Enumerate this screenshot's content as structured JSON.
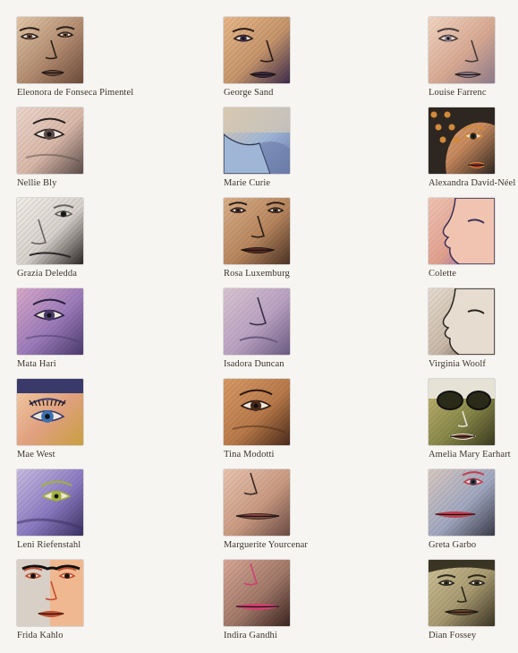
{
  "portraits": [
    {
      "name": "Eleonora de Fonseca Pimentel",
      "palette": [
        "#b08a6e",
        "#6a4a3a",
        "#e2c7a8",
        "#2a1f1a"
      ],
      "feature": "eyes-nose"
    },
    {
      "name": "George Sand",
      "palette": [
        "#c6956a",
        "#3b2a4a",
        "#e8b889",
        "#2a1c18"
      ],
      "feature": "eye-nose"
    },
    {
      "name": "Louise Farrenc",
      "palette": [
        "#d6a890",
        "#8c7a8a",
        "#f0d4c0",
        "#4a3a3a"
      ],
      "feature": "eye-nose"
    },
    {
      "name": "Nellie Bly",
      "palette": [
        "#d8b8a8",
        "#5a4a48",
        "#ecd6cc",
        "#2a2220"
      ],
      "feature": "eye"
    },
    {
      "name": "Marie Curie",
      "palette": [
        "#9fb6d6",
        "#6a7aa8",
        "#d9c9b0",
        "#2e3550"
      ],
      "feature": "collar"
    },
    {
      "name": "Alexandra David-Néel",
      "palette": [
        "#c98a5e",
        "#2e2620",
        "#e0b088",
        "#d08a3a"
      ],
      "feature": "eye-hair"
    },
    {
      "name": "Grazia Deledda",
      "palette": [
        "#d8d2cc",
        "#2a2626",
        "#f0ece6",
        "#6a6460"
      ],
      "feature": "nose-bw"
    },
    {
      "name": "Rosa Luxemburg",
      "palette": [
        "#b8865e",
        "#4a3224",
        "#dab08a",
        "#2a1e16"
      ],
      "feature": "nose-mouth"
    },
    {
      "name": "Colette",
      "palette": [
        "#e0a08a",
        "#6a5ac0",
        "#f0c4b0",
        "#3a3058"
      ],
      "feature": "profile"
    },
    {
      "name": "Mata Hari",
      "palette": [
        "#9a7ab8",
        "#4a3a6a",
        "#d8a8c8",
        "#2a2040"
      ],
      "feature": "eye"
    },
    {
      "name": "Isadora Duncan",
      "palette": [
        "#b8a0c0",
        "#6a5a80",
        "#d8c4d0",
        "#3a3048"
      ],
      "feature": "nose"
    },
    {
      "name": "Virginia Woolf",
      "palette": [
        "#c8b8a8",
        "#4a3e36",
        "#e6dccf",
        "#2a2420"
      ],
      "feature": "profile"
    },
    {
      "name": "Mae West",
      "palette": [
        "#e0a080",
        "#c8a040",
        "#f4cfa8",
        "#3a3a6a"
      ],
      "feature": "eye-lash"
    },
    {
      "name": "Tina Modotti",
      "palette": [
        "#b87a4a",
        "#4a2a1a",
        "#d89a68",
        "#2a1810"
      ],
      "feature": "eye"
    },
    {
      "name": "Amelia Mary Earhart",
      "palette": [
        "#8a8a4a",
        "#3a3a20",
        "#c8b878",
        "#e6e2d6"
      ],
      "feature": "goggles"
    },
    {
      "name": "Leni Riefenstahl",
      "palette": [
        "#8a7ac0",
        "#3a3060",
        "#c8bce0",
        "#a0b040"
      ],
      "feature": "eye-green"
    },
    {
      "name": "Marguerite Yourcenar",
      "palette": [
        "#c89a80",
        "#6a4a44",
        "#e8c4b0",
        "#3a2a26"
      ],
      "feature": "mouth"
    },
    {
      "name": "Greta Garbo",
      "palette": [
        "#a0a8c0",
        "#3a3a48",
        "#d8c8c0",
        "#c04050"
      ],
      "feature": "lips"
    },
    {
      "name": "Frida Kahlo",
      "palette": [
        "#d8cfc6",
        "#2a2020",
        "#f0b890",
        "#c05030"
      ],
      "feature": "split-face"
    },
    {
      "name": "Indira Gandhi",
      "palette": [
        "#a07868",
        "#3a2420",
        "#d8a898",
        "#d04070"
      ],
      "feature": "mouth"
    },
    {
      "name": "Dian Fossey",
      "palette": [
        "#a89a70",
        "#3a3424",
        "#d0c49a",
        "#2a261a"
      ],
      "feature": "face"
    }
  ]
}
